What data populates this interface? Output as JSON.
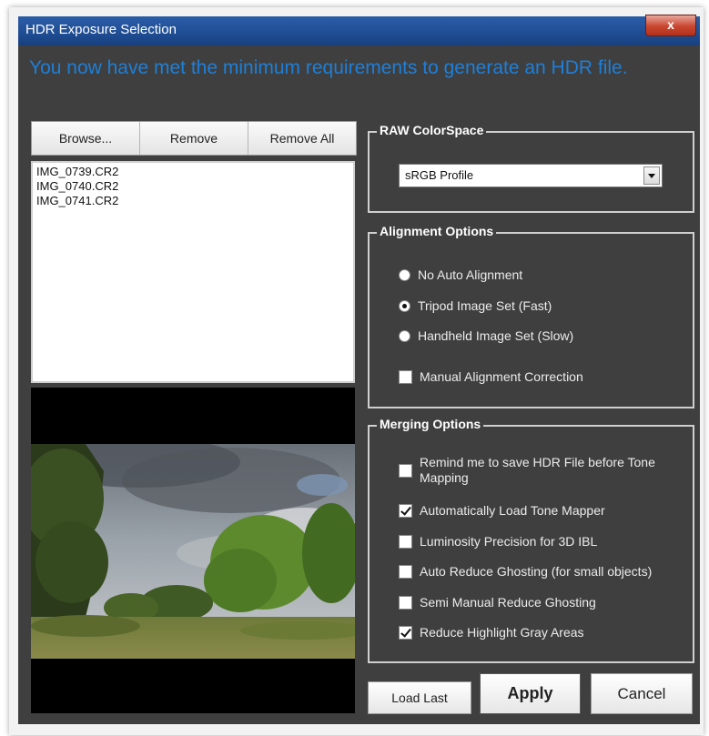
{
  "window": {
    "title": "HDR Exposure Selection",
    "close_label": "x"
  },
  "banner": "You now have met the minimum requirements to generate an HDR file.",
  "file_buttons": {
    "browse": "Browse...",
    "remove": "Remove",
    "remove_all": "Remove All"
  },
  "files": [
    "IMG_0739.CR2",
    "IMG_0740.CR2",
    "IMG_0741.CR2"
  ],
  "raw_colorspace": {
    "title": "RAW ColorSpace",
    "selected": "sRGB Profile"
  },
  "alignment": {
    "title": "Alignment Options",
    "options": [
      {
        "label": "No Auto Alignment",
        "selected": false
      },
      {
        "label": "Tripod Image Set (Fast)",
        "selected": true
      },
      {
        "label": "Handheld Image Set (Slow)",
        "selected": false
      }
    ],
    "manual_correction": {
      "label": "Manual Alignment Correction",
      "checked": false
    }
  },
  "merging": {
    "title": "Merging Options",
    "options": [
      {
        "label": "Remind me to save HDR File before Tone Mapping",
        "checked": false
      },
      {
        "label": "Automatically Load Tone Mapper",
        "checked": true
      },
      {
        "label": "Luminosity Precision for 3D IBL",
        "checked": false
      },
      {
        "label": "Auto Reduce Ghosting (for small objects)",
        "checked": false
      },
      {
        "label": "Semi Manual Reduce Ghosting",
        "checked": false
      },
      {
        "label": "Reduce Highlight Gray Areas",
        "checked": true
      }
    ]
  },
  "actions": {
    "load_last": "Load Last",
    "apply": "Apply",
    "cancel": "Cancel"
  }
}
